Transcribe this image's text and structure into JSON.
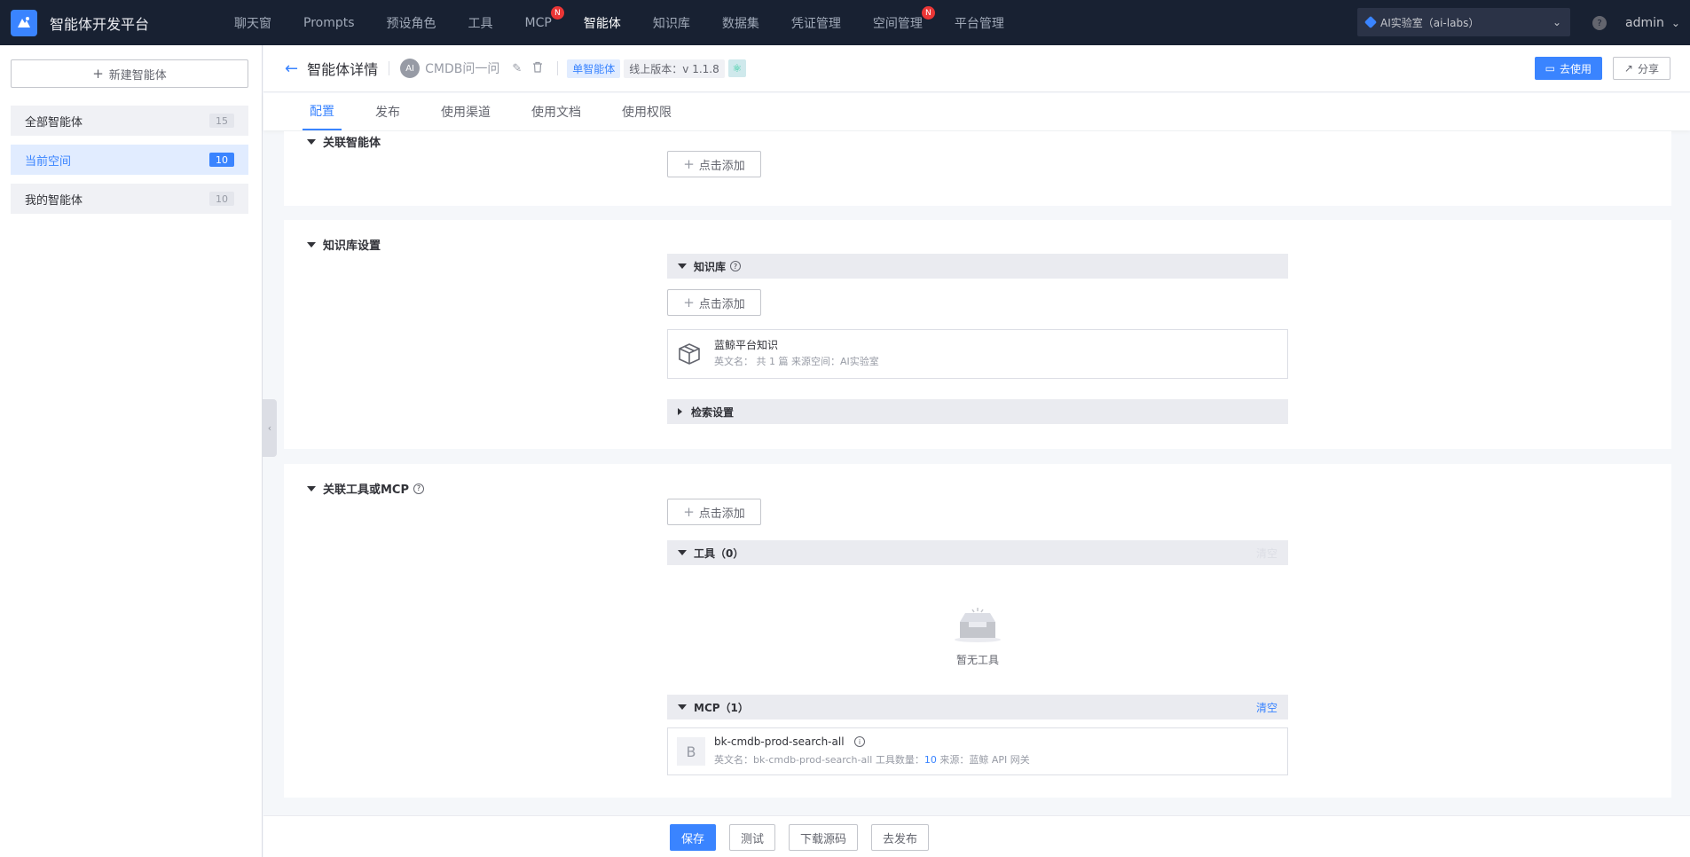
{
  "app": {
    "brand": "智能体开发平台"
  },
  "topnav": {
    "items": [
      {
        "label": "聊天窗",
        "badge": ""
      },
      {
        "label": "Prompts",
        "badge": ""
      },
      {
        "label": "预设角色",
        "badge": ""
      },
      {
        "label": "工具",
        "badge": ""
      },
      {
        "label": "MCP",
        "badge": "N"
      },
      {
        "label": "智能体",
        "badge": "",
        "active": true
      },
      {
        "label": "知识库",
        "badge": ""
      },
      {
        "label": "数据集",
        "badge": ""
      },
      {
        "label": "凭证管理",
        "badge": ""
      },
      {
        "label": "空间管理",
        "badge": "N"
      },
      {
        "label": "平台管理",
        "badge": ""
      }
    ],
    "space_select": "AI实验室（ai-labs）",
    "user": "admin"
  },
  "sidebar": {
    "new_button": "新建智能体",
    "items": [
      {
        "label": "全部智能体",
        "count": "15"
      },
      {
        "label": "当前空间",
        "count": "10"
      },
      {
        "label": "我的智能体",
        "count": "10"
      }
    ]
  },
  "header": {
    "title": "智能体详情",
    "avatar_text": "AI",
    "agent_name": "CMDB问一问",
    "type_tag": "单智能体",
    "version_tag": "线上版本：v 1.1.8",
    "use_button": "去使用",
    "share_button": "分享"
  },
  "tabs": [
    "配置",
    "发布",
    "使用渠道",
    "使用文档",
    "使用权限"
  ],
  "sections": {
    "linked_agents": {
      "title": "关联智能体",
      "add_label": "点击添加"
    },
    "knowledge": {
      "title": "知识库设置",
      "sub_title": "知识库",
      "add_label": "点击添加",
      "item_name": "蓝鲸平台知识",
      "item_meta": "英文名：    共 1 篇    来源空间：AI实验室",
      "retrieval": "检索设置"
    },
    "tools": {
      "title": "关联工具或MCP",
      "add_label": "点击添加",
      "tools_head": "工具（0）",
      "tools_clear": "清空",
      "empty_text": "暂无工具",
      "mcp_head": "MCP（1）",
      "mcp_clear": "清空",
      "mcp_avatar": "B",
      "mcp_name": "bk-cmdb-prod-search-all",
      "mcp_meta_prefix": "英文名：bk-cmdb-prod-search-all   工具数量：",
      "mcp_tool_count": "10",
      "mcp_meta_suffix": "   来源：蓝鲸 API 网关"
    }
  },
  "footer": {
    "save": "保存",
    "test": "测试",
    "download": "下载源码",
    "publish": "去发布"
  },
  "colors": {
    "primary": "#3a84ff",
    "nav_bg": "#182132",
    "badge": "#ea3636"
  }
}
